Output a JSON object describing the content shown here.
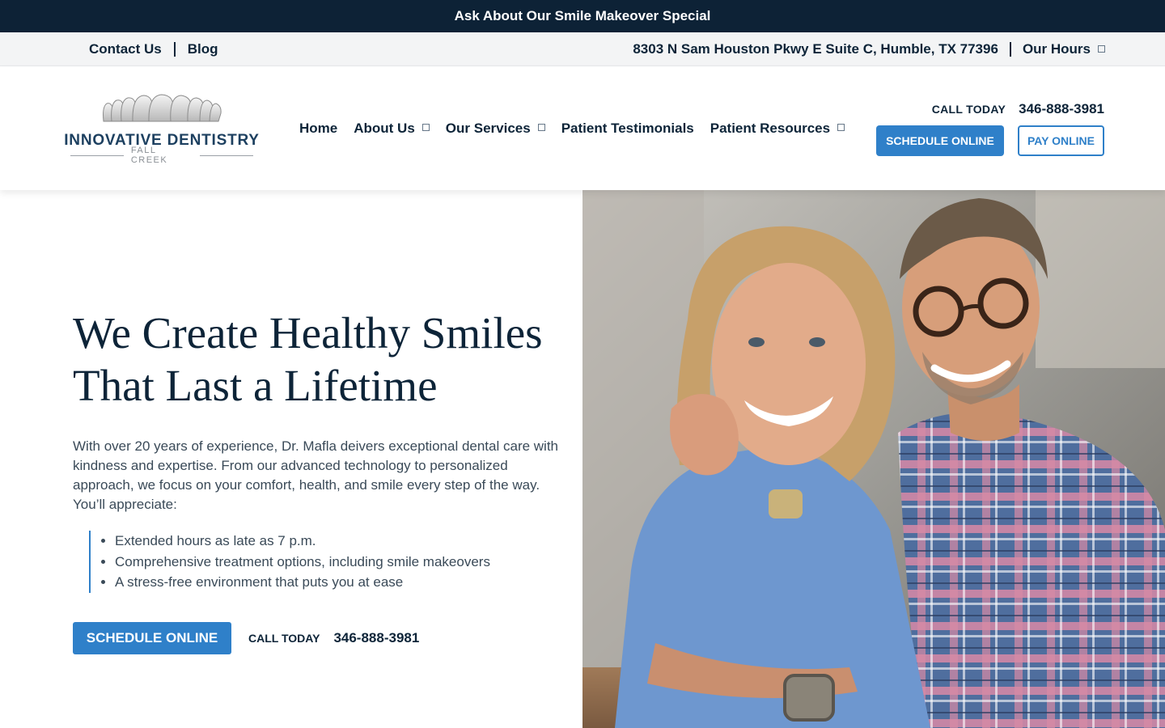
{
  "promo": {
    "text": "Ask About Our Smile Makeover Special"
  },
  "utility": {
    "contact_label": "Contact Us",
    "blog_label": "Blog",
    "address": "8303 N Sam Houston Pkwy E Suite C, Humble, TX 77396",
    "hours_label": "Our Hours"
  },
  "logo": {
    "title": "INNOVATIVE DENTISTRY",
    "subtitle": "FALL CREEK"
  },
  "nav": {
    "items": [
      {
        "label": "Home",
        "has_dropdown": false
      },
      {
        "label": "About Us",
        "has_dropdown": true
      },
      {
        "label": "Our Services",
        "has_dropdown": true
      },
      {
        "label": "Patient Testimonials",
        "has_dropdown": false
      },
      {
        "label": "Patient Resources",
        "has_dropdown": true
      }
    ]
  },
  "header_cta": {
    "call_label": "CALL TODAY",
    "phone": "346-888-3981",
    "schedule_label": "SCHEDULE ONLINE",
    "pay_label": "PAY ONLINE"
  },
  "hero": {
    "title_line1": "We Create Healthy Smiles",
    "title_line2": "That Last a Lifetime",
    "body": "With over 20 years of experience, Dr. Mafla deivers exceptional dental care with kindness and expertise. From our advanced technology to personalized approach, we focus on your comfort, health, and smile every step of the way. You’ll appreciate:",
    "bullets": [
      "Extended hours as late as 7 p.m.",
      "Comprehensive treatment options, including smile makeovers",
      "A stress-free environment that puts you at ease"
    ],
    "schedule_label": "SCHEDULE ONLINE",
    "call_label": "CALL TODAY",
    "phone": "346-888-3981"
  },
  "colors": {
    "navy": "#0d2236",
    "accent_blue": "#2f80c9",
    "text_body": "#3a4a58"
  },
  "icons": {
    "dropdown": "chevron-down-icon",
    "hero_image": "smiling-couple-photo"
  }
}
